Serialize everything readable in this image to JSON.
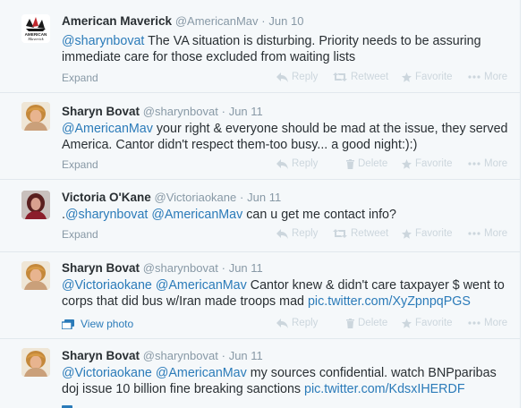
{
  "tweets": [
    {
      "name": "American Maverick",
      "handle": "@AmericanMav",
      "time": "Jun 10",
      "text_parts": [
        "@sharynbovat",
        " The VA situation is disturbing.  Priority needs to be assuring immediate care for those excluded from waiting lists"
      ],
      "expand": "Expand",
      "actions": [
        "Reply",
        "Retweet",
        "Favorite",
        "More"
      ],
      "avatar_text": [
        "AMERICAN",
        "Maverick"
      ]
    },
    {
      "name": "Sharyn Bovat",
      "handle": "@sharynbovat",
      "time": "Jun 11",
      "text_parts": [
        "@AmericanMav",
        " your right & everyone should be mad at the issue, they served America. Cantor didn't respect them-too busy... a good night:):)"
      ],
      "expand": "Expand",
      "actions": [
        "Reply",
        "Delete",
        "Favorite",
        "More"
      ]
    },
    {
      "name": "Victoria O'Kane",
      "handle": "@Victoriaokane",
      "time": "Jun 11",
      "text_parts": [
        ".",
        "@sharynbovat",
        " ",
        "@AmericanMav",
        " can u get me contact info?"
      ],
      "expand": "Expand",
      "actions": [
        "Reply",
        "Retweet",
        "Favorite",
        "More"
      ]
    },
    {
      "name": "Sharyn Bovat",
      "handle": "@sharynbovat",
      "time": "Jun 11",
      "text_parts": [
        "@Victoriaokane",
        " ",
        "@AmericanMav",
        " Cantor knew & didn't care taxpayer $ went to corps that did bus w/Iran made troops mad ",
        "pic.twitter.com/XyZpnpqPGS"
      ],
      "expand": "View photo",
      "actions": [
        "Reply",
        "Delete",
        "Favorite",
        "More"
      ]
    },
    {
      "name": "Sharyn Bovat",
      "handle": "@sharynbovat",
      "time": "Jun 11",
      "text_parts": [
        "@Victoriaokane",
        " ",
        "@AmericanMav",
        " my sources confidential. watch BNPparibas doj issue 10 billion fine breaking sanctions ",
        "pic.twitter.com/KdsxIHERDF"
      ]
    }
  ],
  "separator": "·",
  "colors": {
    "link": "#2b7bb9",
    "muted": "#8899a6",
    "action": "#ccd6dd",
    "alt_bg": "#f5f8fa",
    "border": "#e1e8ed"
  }
}
